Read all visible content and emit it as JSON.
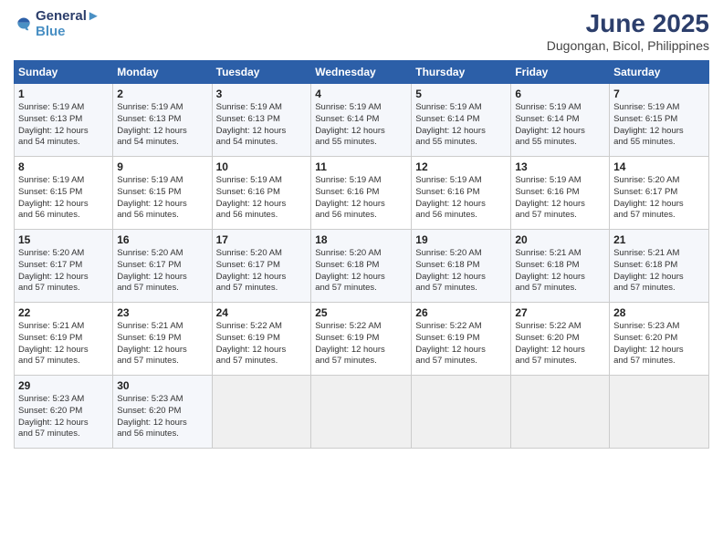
{
  "logo": {
    "line1": "General",
    "line2": "Blue"
  },
  "title": "June 2025",
  "location": "Dugongan, Bicol, Philippines",
  "weekdays": [
    "Sunday",
    "Monday",
    "Tuesday",
    "Wednesday",
    "Thursday",
    "Friday",
    "Saturday"
  ],
  "weeks": [
    [
      {
        "day": "1",
        "info": "Sunrise: 5:19 AM\nSunset: 6:13 PM\nDaylight: 12 hours\nand 54 minutes."
      },
      {
        "day": "2",
        "info": "Sunrise: 5:19 AM\nSunset: 6:13 PM\nDaylight: 12 hours\nand 54 minutes."
      },
      {
        "day": "3",
        "info": "Sunrise: 5:19 AM\nSunset: 6:13 PM\nDaylight: 12 hours\nand 54 minutes."
      },
      {
        "day": "4",
        "info": "Sunrise: 5:19 AM\nSunset: 6:14 PM\nDaylight: 12 hours\nand 55 minutes."
      },
      {
        "day": "5",
        "info": "Sunrise: 5:19 AM\nSunset: 6:14 PM\nDaylight: 12 hours\nand 55 minutes."
      },
      {
        "day": "6",
        "info": "Sunrise: 5:19 AM\nSunset: 6:14 PM\nDaylight: 12 hours\nand 55 minutes."
      },
      {
        "day": "7",
        "info": "Sunrise: 5:19 AM\nSunset: 6:15 PM\nDaylight: 12 hours\nand 55 minutes."
      }
    ],
    [
      {
        "day": "8",
        "info": "Sunrise: 5:19 AM\nSunset: 6:15 PM\nDaylight: 12 hours\nand 56 minutes."
      },
      {
        "day": "9",
        "info": "Sunrise: 5:19 AM\nSunset: 6:15 PM\nDaylight: 12 hours\nand 56 minutes."
      },
      {
        "day": "10",
        "info": "Sunrise: 5:19 AM\nSunset: 6:16 PM\nDaylight: 12 hours\nand 56 minutes."
      },
      {
        "day": "11",
        "info": "Sunrise: 5:19 AM\nSunset: 6:16 PM\nDaylight: 12 hours\nand 56 minutes."
      },
      {
        "day": "12",
        "info": "Sunrise: 5:19 AM\nSunset: 6:16 PM\nDaylight: 12 hours\nand 56 minutes."
      },
      {
        "day": "13",
        "info": "Sunrise: 5:19 AM\nSunset: 6:16 PM\nDaylight: 12 hours\nand 57 minutes."
      },
      {
        "day": "14",
        "info": "Sunrise: 5:20 AM\nSunset: 6:17 PM\nDaylight: 12 hours\nand 57 minutes."
      }
    ],
    [
      {
        "day": "15",
        "info": "Sunrise: 5:20 AM\nSunset: 6:17 PM\nDaylight: 12 hours\nand 57 minutes."
      },
      {
        "day": "16",
        "info": "Sunrise: 5:20 AM\nSunset: 6:17 PM\nDaylight: 12 hours\nand 57 minutes."
      },
      {
        "day": "17",
        "info": "Sunrise: 5:20 AM\nSunset: 6:17 PM\nDaylight: 12 hours\nand 57 minutes."
      },
      {
        "day": "18",
        "info": "Sunrise: 5:20 AM\nSunset: 6:18 PM\nDaylight: 12 hours\nand 57 minutes."
      },
      {
        "day": "19",
        "info": "Sunrise: 5:20 AM\nSunset: 6:18 PM\nDaylight: 12 hours\nand 57 minutes."
      },
      {
        "day": "20",
        "info": "Sunrise: 5:21 AM\nSunset: 6:18 PM\nDaylight: 12 hours\nand 57 minutes."
      },
      {
        "day": "21",
        "info": "Sunrise: 5:21 AM\nSunset: 6:18 PM\nDaylight: 12 hours\nand 57 minutes."
      }
    ],
    [
      {
        "day": "22",
        "info": "Sunrise: 5:21 AM\nSunset: 6:19 PM\nDaylight: 12 hours\nand 57 minutes."
      },
      {
        "day": "23",
        "info": "Sunrise: 5:21 AM\nSunset: 6:19 PM\nDaylight: 12 hours\nand 57 minutes."
      },
      {
        "day": "24",
        "info": "Sunrise: 5:22 AM\nSunset: 6:19 PM\nDaylight: 12 hours\nand 57 minutes."
      },
      {
        "day": "25",
        "info": "Sunrise: 5:22 AM\nSunset: 6:19 PM\nDaylight: 12 hours\nand 57 minutes."
      },
      {
        "day": "26",
        "info": "Sunrise: 5:22 AM\nSunset: 6:19 PM\nDaylight: 12 hours\nand 57 minutes."
      },
      {
        "day": "27",
        "info": "Sunrise: 5:22 AM\nSunset: 6:20 PM\nDaylight: 12 hours\nand 57 minutes."
      },
      {
        "day": "28",
        "info": "Sunrise: 5:23 AM\nSunset: 6:20 PM\nDaylight: 12 hours\nand 57 minutes."
      }
    ],
    [
      {
        "day": "29",
        "info": "Sunrise: 5:23 AM\nSunset: 6:20 PM\nDaylight: 12 hours\nand 57 minutes."
      },
      {
        "day": "30",
        "info": "Sunrise: 5:23 AM\nSunset: 6:20 PM\nDaylight: 12 hours\nand 56 minutes."
      },
      {
        "day": "",
        "info": ""
      },
      {
        "day": "",
        "info": ""
      },
      {
        "day": "",
        "info": ""
      },
      {
        "day": "",
        "info": ""
      },
      {
        "day": "",
        "info": ""
      }
    ]
  ]
}
